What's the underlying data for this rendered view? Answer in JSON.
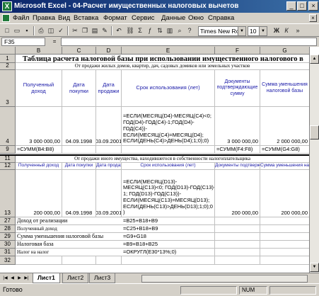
{
  "window": {
    "title": "Microsoft Excel - 04-Расчет имущественных налоговых вычетов",
    "app_icon": "excel-icon",
    "buttons": [
      "_",
      "□",
      "×"
    ]
  },
  "menu": {
    "items": [
      "Файл",
      "Правка",
      "Вид",
      "Вставка",
      "Формат",
      "Сервис",
      "Данные",
      "Окно",
      "Справка"
    ]
  },
  "toolbar": {
    "icons": [
      "new-icon",
      "open-icon",
      "save-icon",
      "print-icon",
      "print-preview-icon",
      "spelling-icon",
      "cut-icon",
      "copy-icon",
      "paste-icon",
      "format-painter-icon",
      "undo-icon",
      "hyperlink-icon",
      "autosum-icon",
      "function-icon",
      "sort-asc-icon",
      "chart-wizard-icon",
      "zoom-icon",
      "help-icon"
    ],
    "zoom_value": "",
    "font_name": "Times New Roman Cyr",
    "font_size": "10",
    "bold": "Ж",
    "italic": "К"
  },
  "formula_bar": {
    "name_box": "F35",
    "fx": "=",
    "formula": ""
  },
  "columns": [
    "B",
    "C",
    "D",
    "E",
    "F",
    "G"
  ],
  "rows": {
    "r1": {
      "num": "1",
      "title": "Таблица расчета налоговой базы при использовании имущественного налогового в"
    },
    "r2": {
      "num": "2",
      "subhead": "От продажи жилых домов, квартир, дач, садовых домиков или земельных участков"
    },
    "r3": {
      "num": "3",
      "cells": [
        "Полученный доход",
        "Дата покупки",
        "Дата продажи",
        "Срок использования (лет)",
        "Документы подтверждающие сумму",
        "Сумма уменьшения налоговой базы"
      ]
    },
    "r4": {
      "num": "4",
      "b": "3 000 000,00",
      "c": "04.09.1998",
      "d": "03.09.2001",
      "e": "=ЕСЛИ(МЕСЯЦ(D4)-МЕСЯЦ(C4)<0;\nГОД(D4)-ГОД(C4)-1;ГОД(D4)-\nГОД(C4))-\nЕСЛИ(МЕСЯЦ(C4)=МЕСЯЦ(D4);\nЕСЛИ(ДЕНЬ(C4)>ДЕНЬ(D4);1;0);0)",
      "f": "3 000 000,00",
      "g": "2 000 000,00"
    },
    "r9": {
      "num": "9",
      "b": "=СУММ(B4:B8)",
      "f": "=СУММ(F4:F8)",
      "g": "=СУММ(G4:G8)"
    },
    "r11": {
      "num": "11",
      "subhead": "От продажи иного имущества, находившегося в собственности налогоплательщика"
    },
    "r12": {
      "num": "12",
      "cells": [
        "Полученный доход",
        "Дата покупки",
        "Дата продажи",
        "Срок использования (лет)",
        "Документы подтверждающие сумму",
        "Сумма уменьшения налоговой базы"
      ]
    },
    "r13": {
      "num": "13",
      "b": "200 000,00",
      "c": "04.09.1998",
      "d": "03.09.2001",
      "e": "=ЕСЛИ(МЕСЯЦ(D13)-\nМЕСЯЦ(C13)<0; ГОД(D13)-ГОД(C13)-\n1; ГОД(D13)-ГОД(C13))-\nЕСЛИ(МЕСЯЦ(C13)=МЕСЯЦ(D13);\nЕСЛИ(ДЕНЬ(C13)>ДЕНЬ(D13);1;0);0\n)",
      "f": "200 000,00",
      "g": "200 000,00"
    },
    "r27": {
      "num": "27",
      "label": "Доход от реализации",
      "formula": "=B25+B18+B9"
    },
    "r28": {
      "num": "28",
      "label": "Полученный доход",
      "formula": "=C25+B18+B9"
    },
    "r29": {
      "num": "29",
      "label": "Сумма уменьшения налоговой базы",
      "formula": "=G9+G18"
    },
    "r30": {
      "num": "30",
      "label": "Налоговая база",
      "formula": "=B9+B18+B25"
    },
    "r31": {
      "num": "31",
      "label": "Налог на налог",
      "formula": "=ОКРУГЛ(E30*13%;0)"
    },
    "r32": {
      "num": "32"
    }
  },
  "sheets": {
    "tabs": [
      "Лист1",
      "Лист2",
      "Лист3"
    ],
    "active": "Лист1"
  },
  "status": {
    "text": "Готово",
    "num": "NUM"
  }
}
